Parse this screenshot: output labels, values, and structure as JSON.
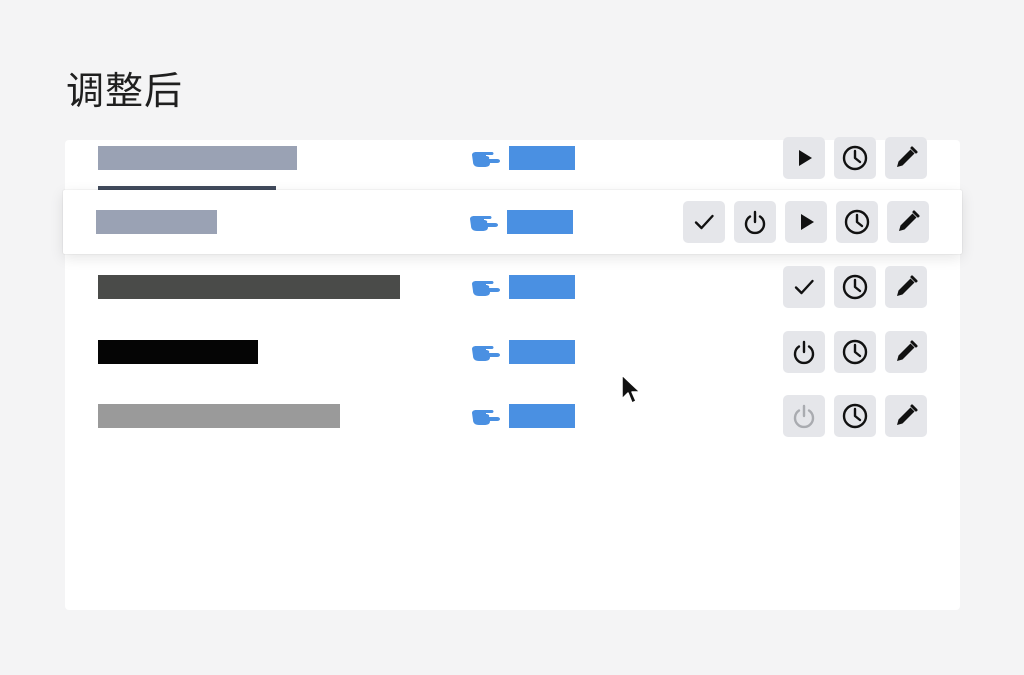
{
  "page": {
    "title": "调整后"
  },
  "colors": {
    "page_bg": "#f4f4f5",
    "card_bg": "#ffffff",
    "link_accent": "#4a90e2",
    "button_bg": "#e5e6ea",
    "icon_dark": "#111111",
    "icon_disabled": "#a9abb0",
    "heading_bar": "#414a5c"
  },
  "card": {
    "heading_bar_color": "#414a5c",
    "rows": [
      {
        "name_bar_color": "#9aa2b4",
        "name_bar_fraction": 0.66,
        "hovered": false,
        "actions": [
          "play",
          "clock",
          "edit"
        ]
      },
      {
        "name_bar_color": "#9aa2b4",
        "name_bar_fraction": 0.4,
        "hovered": true,
        "actions": [
          "check",
          "power",
          "play",
          "clock",
          "edit"
        ]
      },
      {
        "name_bar_color": "#4a4b49",
        "name_bar_fraction": 1.0,
        "hovered": false,
        "actions": [
          "check",
          "clock",
          "edit"
        ]
      },
      {
        "name_bar_color": "#050505",
        "name_bar_fraction": 0.53,
        "hovered": false,
        "actions": [
          "power",
          "clock",
          "edit"
        ]
      },
      {
        "name_bar_color": "#9a9a9a",
        "name_bar_fraction": 0.8,
        "hovered": false,
        "actions": [
          "power-disabled",
          "clock",
          "edit"
        ]
      }
    ]
  }
}
